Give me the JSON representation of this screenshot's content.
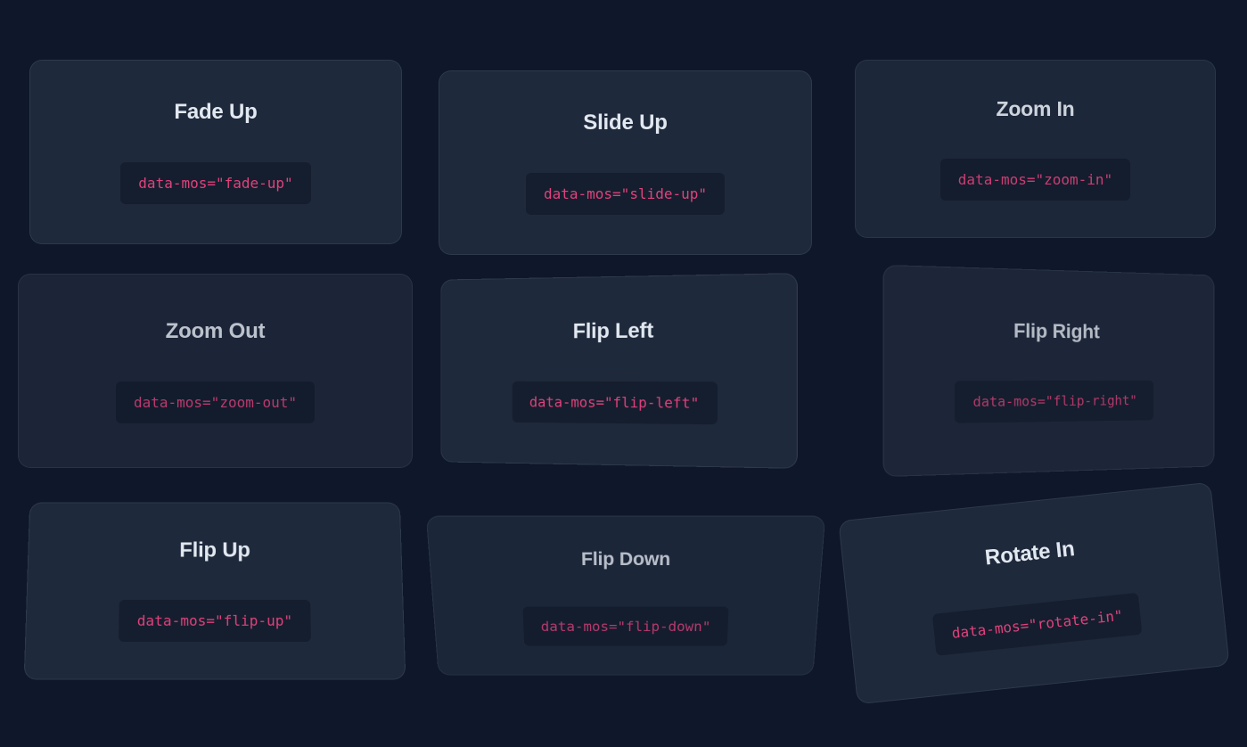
{
  "cards": [
    {
      "title": "Fade Up",
      "code": "data-mos=\"fade-up\""
    },
    {
      "title": "Slide Up",
      "code": "data-mos=\"slide-up\""
    },
    {
      "title": "Zoom In",
      "code": "data-mos=\"zoom-in\""
    },
    {
      "title": "Zoom Out",
      "code": "data-mos=\"zoom-out\""
    },
    {
      "title": "Flip Left",
      "code": "data-mos=\"flip-left\""
    },
    {
      "title": "Flip Right",
      "code": "data-mos=\"flip-right\""
    },
    {
      "title": "Flip Up",
      "code": "data-mos=\"flip-up\""
    },
    {
      "title": "Flip Down",
      "code": "data-mos=\"flip-down\""
    },
    {
      "title": "Rotate In",
      "code": "data-mos=\"rotate-in\""
    }
  ],
  "colors": {
    "background": "#0f172a",
    "card": "#1e293b",
    "code_text": "#e0427c",
    "title_text": "#e2e8f0"
  }
}
